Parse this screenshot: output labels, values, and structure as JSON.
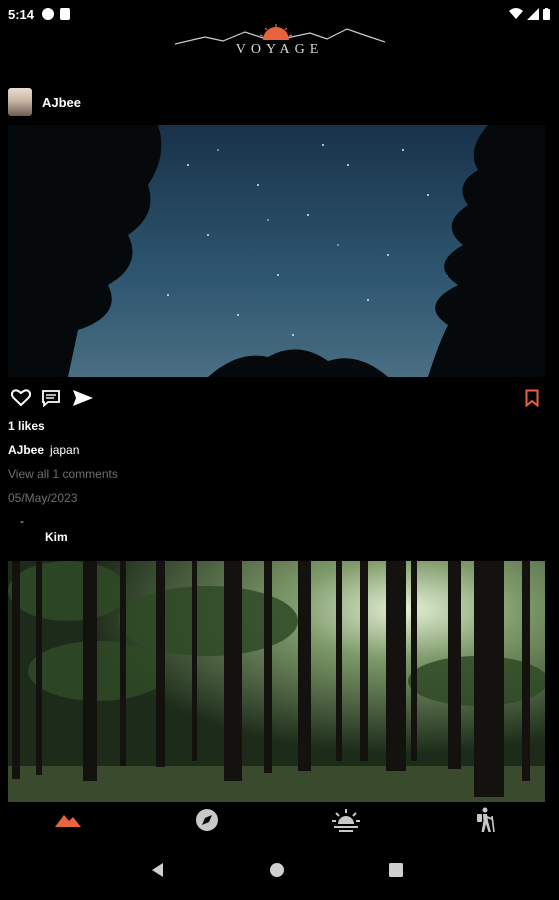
{
  "status_bar": {
    "time": "5:14"
  },
  "header": {
    "logo_text": "VOYAGE"
  },
  "post1": {
    "username": "AJbee",
    "likes": "1 likes",
    "caption_user": "AJbee",
    "caption_text": "japan",
    "view_comments": "View all 1 comments",
    "date": "05/May/2023"
  },
  "post2": {
    "dash": "-",
    "username": "Kim"
  },
  "bottom_nav": {
    "items": [
      {
        "icon": "mountains-icon",
        "active": true
      },
      {
        "icon": "compass-icon",
        "active": false
      },
      {
        "icon": "sunrise-icon",
        "active": false
      },
      {
        "icon": "hiker-icon",
        "active": false
      }
    ]
  },
  "colors": {
    "accent": "#e8643c",
    "muted": "#6f6f6f",
    "background": "#000000"
  }
}
